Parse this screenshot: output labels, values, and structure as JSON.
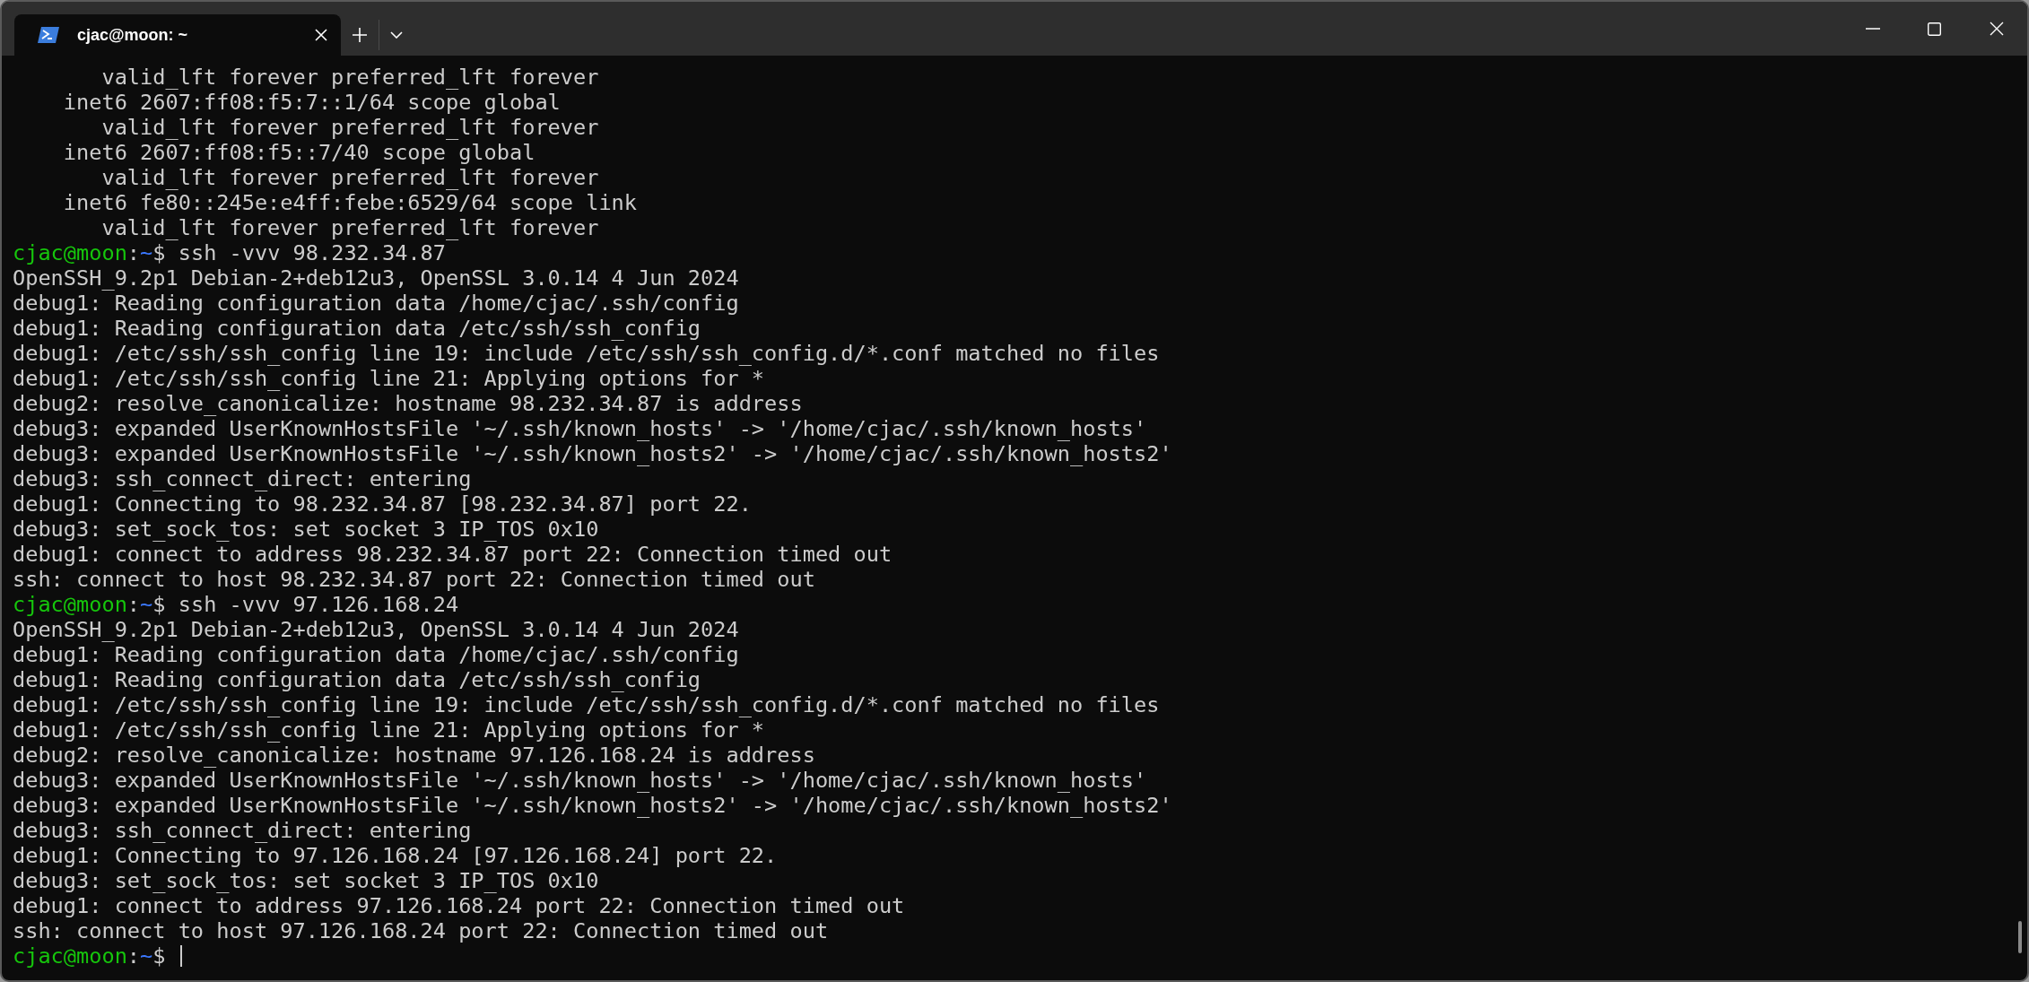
{
  "tabs": [
    {
      "title": "cjac@moon: ~",
      "selected": true
    }
  ],
  "terminal": {
    "lines": [
      {
        "kind": "output",
        "text": "       valid_lft forever preferred_lft forever"
      },
      {
        "kind": "output",
        "text": "    inet6 2607:ff08:f5:7::1/64 scope global"
      },
      {
        "kind": "output",
        "text": "       valid_lft forever preferred_lft forever"
      },
      {
        "kind": "output",
        "text": "    inet6 2607:ff08:f5::7/40 scope global"
      },
      {
        "kind": "output",
        "text": "       valid_lft forever preferred_lft forever"
      },
      {
        "kind": "output",
        "text": "    inet6 fe80::245e:e4ff:febe:6529/64 scope link"
      },
      {
        "kind": "output",
        "text": "       valid_lft forever preferred_lft forever"
      },
      {
        "kind": "prompt",
        "user": "cjac@moon",
        "separator": ":",
        "path": "~",
        "symbol": "$",
        "command": "ssh -vvv 98.232.34.87",
        "cursor": false
      },
      {
        "kind": "output",
        "text": "OpenSSH_9.2p1 Debian-2+deb12u3, OpenSSL 3.0.14 4 Jun 2024"
      },
      {
        "kind": "output",
        "text": "debug1: Reading configuration data /home/cjac/.ssh/config"
      },
      {
        "kind": "output",
        "text": "debug1: Reading configuration data /etc/ssh/ssh_config"
      },
      {
        "kind": "output",
        "text": "debug1: /etc/ssh/ssh_config line 19: include /etc/ssh/ssh_config.d/*.conf matched no files"
      },
      {
        "kind": "output",
        "text": "debug1: /etc/ssh/ssh_config line 21: Applying options for *"
      },
      {
        "kind": "output",
        "text": "debug2: resolve_canonicalize: hostname 98.232.34.87 is address"
      },
      {
        "kind": "output",
        "text": "debug3: expanded UserKnownHostsFile '~/.ssh/known_hosts' -> '/home/cjac/.ssh/known_hosts'"
      },
      {
        "kind": "output",
        "text": "debug3: expanded UserKnownHostsFile '~/.ssh/known_hosts2' -> '/home/cjac/.ssh/known_hosts2'"
      },
      {
        "kind": "output",
        "text": "debug3: ssh_connect_direct: entering"
      },
      {
        "kind": "output",
        "text": "debug1: Connecting to 98.232.34.87 [98.232.34.87] port 22."
      },
      {
        "kind": "output",
        "text": "debug3: set_sock_tos: set socket 3 IP_TOS 0x10"
      },
      {
        "kind": "output",
        "text": "debug1: connect to address 98.232.34.87 port 22: Connection timed out"
      },
      {
        "kind": "output",
        "text": "ssh: connect to host 98.232.34.87 port 22: Connection timed out"
      },
      {
        "kind": "prompt",
        "user": "cjac@moon",
        "separator": ":",
        "path": "~",
        "symbol": "$",
        "command": "ssh -vvv 97.126.168.24",
        "cursor": false
      },
      {
        "kind": "output",
        "text": "OpenSSH_9.2p1 Debian-2+deb12u3, OpenSSL 3.0.14 4 Jun 2024"
      },
      {
        "kind": "output",
        "text": "debug1: Reading configuration data /home/cjac/.ssh/config"
      },
      {
        "kind": "output",
        "text": "debug1: Reading configuration data /etc/ssh/ssh_config"
      },
      {
        "kind": "output",
        "text": "debug1: /etc/ssh/ssh_config line 19: include /etc/ssh/ssh_config.d/*.conf matched no files"
      },
      {
        "kind": "output",
        "text": "debug1: /etc/ssh/ssh_config line 21: Applying options for *"
      },
      {
        "kind": "output",
        "text": "debug2: resolve_canonicalize: hostname 97.126.168.24 is address"
      },
      {
        "kind": "output",
        "text": "debug3: expanded UserKnownHostsFile '~/.ssh/known_hosts' -> '/home/cjac/.ssh/known_hosts'"
      },
      {
        "kind": "output",
        "text": "debug3: expanded UserKnownHostsFile '~/.ssh/known_hosts2' -> '/home/cjac/.ssh/known_hosts2'"
      },
      {
        "kind": "output",
        "text": "debug3: ssh_connect_direct: entering"
      },
      {
        "kind": "output",
        "text": "debug1: Connecting to 97.126.168.24 [97.126.168.24] port 22."
      },
      {
        "kind": "output",
        "text": "debug3: set_sock_tos: set socket 3 IP_TOS 0x10"
      },
      {
        "kind": "output",
        "text": "debug1: connect to address 97.126.168.24 port 22: Connection timed out"
      },
      {
        "kind": "output",
        "text": "ssh: connect to host 97.126.168.24 port 22: Connection timed out"
      },
      {
        "kind": "prompt",
        "user": "cjac@moon",
        "separator": ":",
        "path": "~",
        "symbol": "$",
        "cursor": true
      }
    ]
  }
}
